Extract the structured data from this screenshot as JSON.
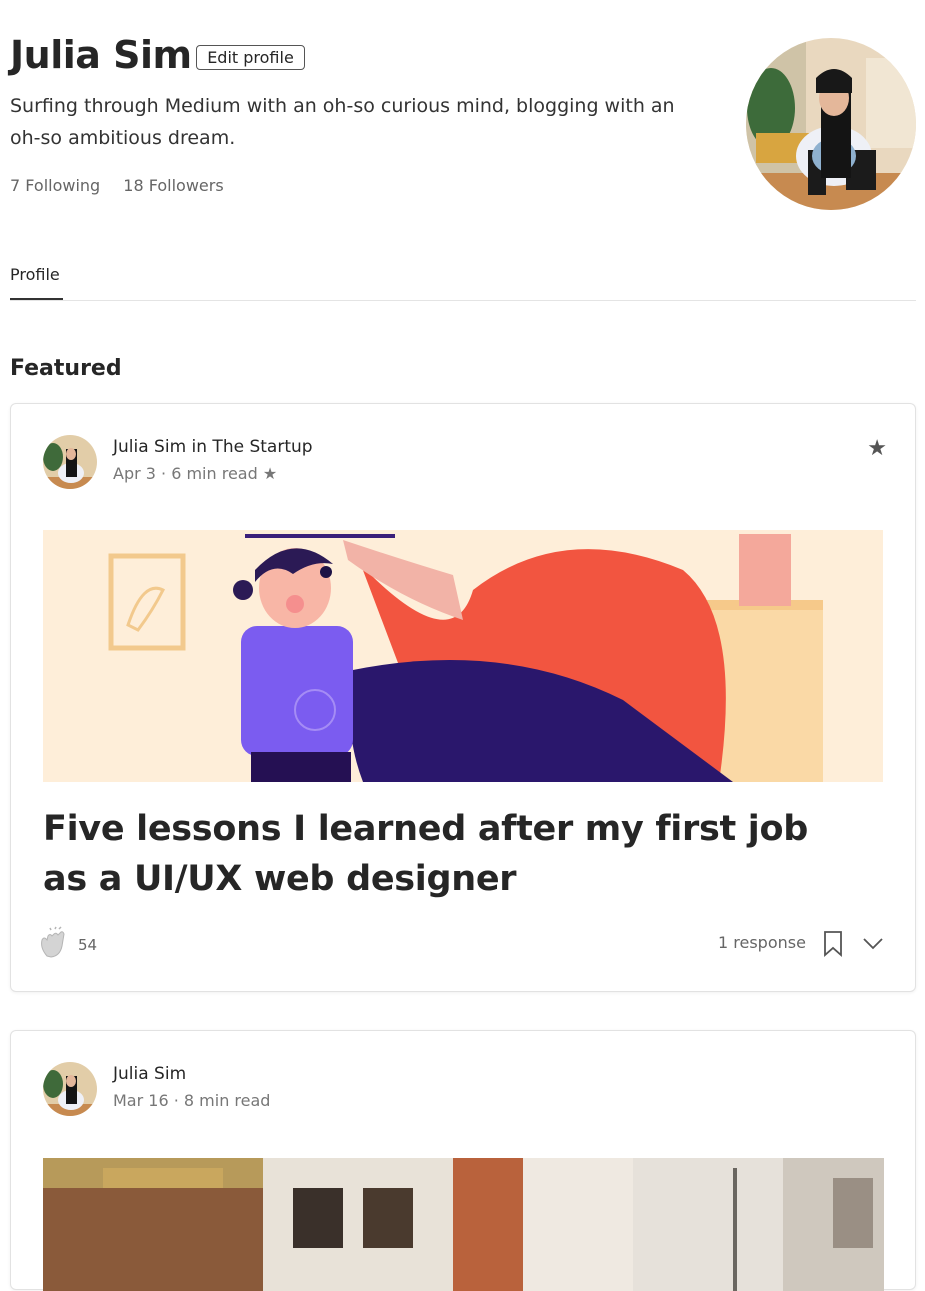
{
  "profile": {
    "name": "Julia Sim",
    "edit_label": "Edit profile",
    "bio": "Surfing through Medium with an oh-so curious mind, blogging with an oh-so ambitious dream.",
    "following": "7 Following",
    "followers": "18 Followers"
  },
  "tabs": {
    "profile": "Profile"
  },
  "featured_heading": "Featured",
  "posts": [
    {
      "author": "Julia Sim in The Startup",
      "meta": "Apr 3 · 6 min read ★",
      "title": "Five lessons I learned after my first job as a UI/UX web designer",
      "claps": "54",
      "responses": "1 response"
    },
    {
      "author": "Julia Sim",
      "meta": "Mar 16 · 8 min read"
    }
  ],
  "colors": {
    "accent": "#262626",
    "muted": "#777777",
    "border": "#e2e2e2"
  },
  "icons": [
    "star-icon",
    "clap-icon",
    "bookmark-icon",
    "chevron-down-icon"
  ]
}
